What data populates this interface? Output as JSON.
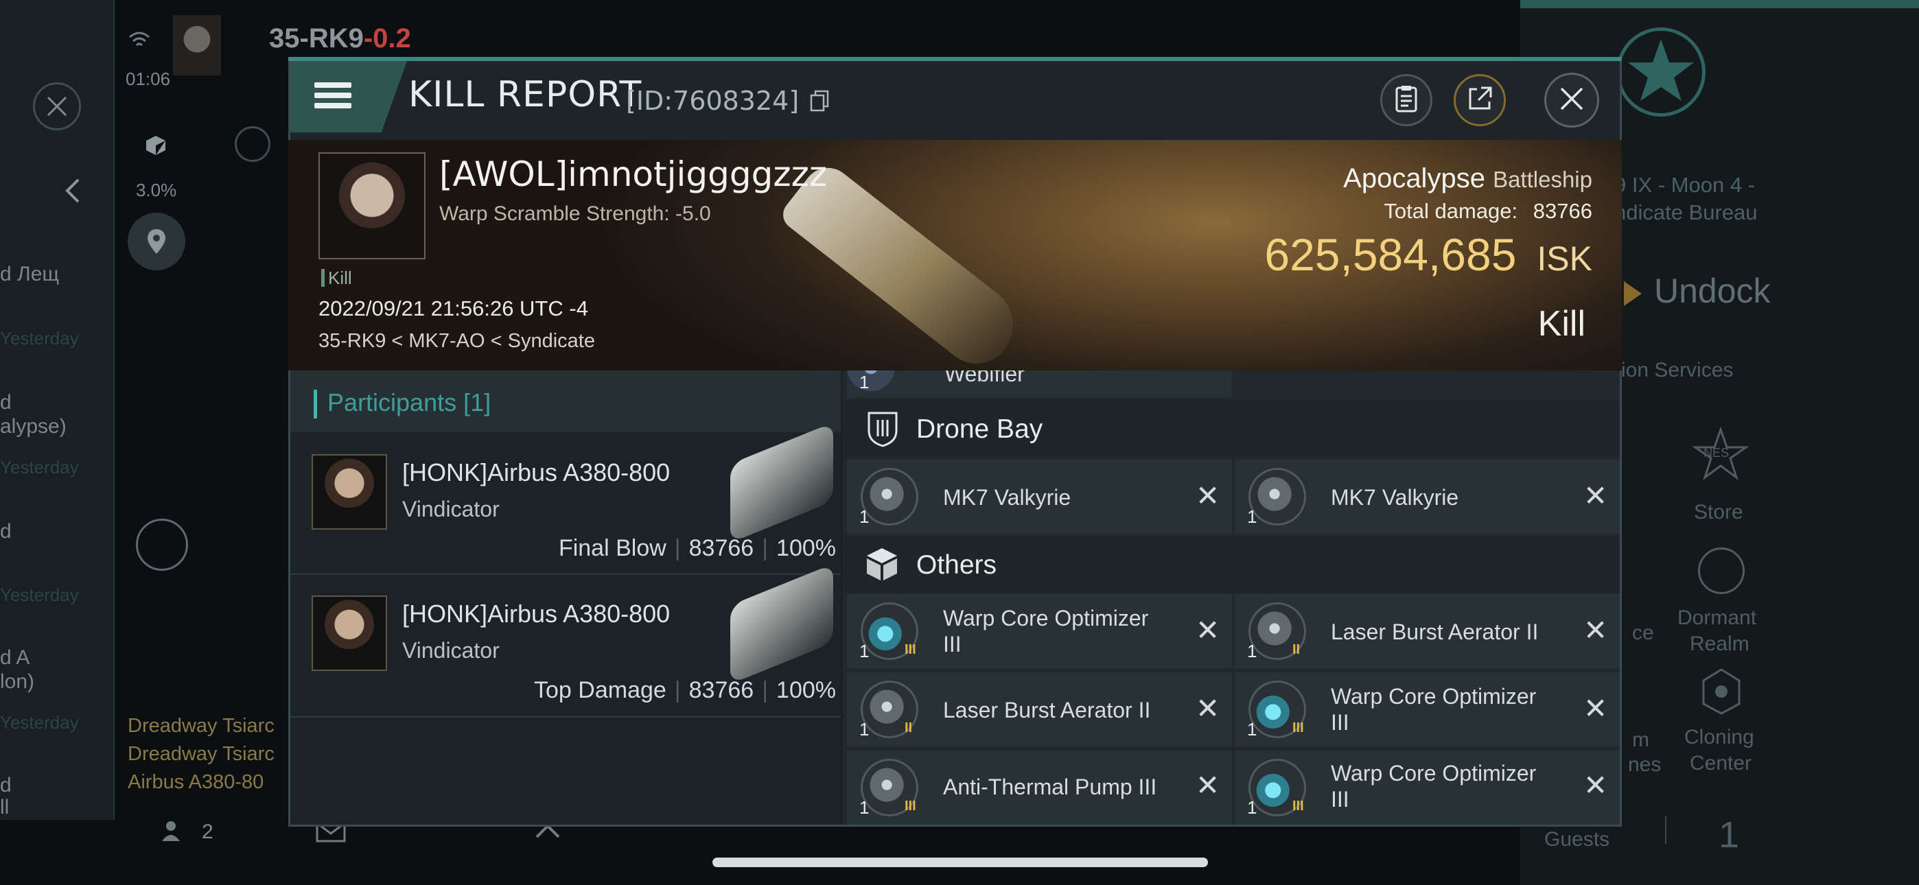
{
  "background": {
    "system_name": "35-RK9",
    "system_security": "-0.2",
    "clock": "01:06",
    "percent": "3.0%",
    "left_list": [
      "d Лещ",
      "Yesterday",
      "d",
      "alypse)",
      "Yesterday",
      "d",
      "Yesterday",
      "d A",
      "lon)",
      "Yesterday",
      "d",
      "ll"
    ],
    "chat_lines": [
      "Dreadway Tsiarc",
      "Dreadway Tsiarc",
      "Airbus A380-80"
    ],
    "bottom_count": "2",
    "station_text_1": "9 IX - Moon 4 -",
    "station_text_2": "ndicate Bureau",
    "undock": "Undock",
    "services": "ion Services",
    "store": "Store",
    "dormant_1": "Dormant",
    "dormant_2": "Realm",
    "cloning_1": "Cloning",
    "cloning_2": "Center",
    "frag_ce": "ce",
    "frag_m": "m",
    "frag_nes": "nes",
    "nes_logo": "NES",
    "guests": "Guests",
    "guests_count": "1"
  },
  "header": {
    "title": "KILL REPORT",
    "report_id": "[ID:7608324]"
  },
  "victim": {
    "pilot": "[AWOL]imnotjiggggzzz",
    "warp_scramble": "Warp Scramble Strength: -5.0",
    "tag": "Kill",
    "datetime": "2022/09/21 21:56:26 UTC -4",
    "location": "35-RK9 < MK7-AO < Syndicate",
    "ship": "Apocalypse",
    "ship_class": "Battleship",
    "total_damage_label": "Total damage:",
    "total_damage": "83766",
    "isk_value": "625,584,685",
    "isk_unit": "ISK",
    "result": "Kill"
  },
  "participants": {
    "label": "Participants",
    "count": "[1]",
    "rows": [
      {
        "pilot": "[HONK]Airbus A380-800",
        "ship": "Vindicator",
        "role": "Final Blow",
        "damage": "83766",
        "percent": "100%"
      },
      {
        "pilot": "[HONK]Airbus A380-800",
        "ship": "Vindicator",
        "role": "Top Damage",
        "damage": "83766",
        "percent": "100%"
      }
    ]
  },
  "items": {
    "partial_top": {
      "qty": "1",
      "name": "Webifier"
    },
    "drone_bay": {
      "label": "Drone Bay",
      "items": [
        {
          "qty": "1",
          "name": "MK7  Valkyrie"
        },
        {
          "qty": "1",
          "name": "MK7  Valkyrie"
        }
      ]
    },
    "others": {
      "label": "Others",
      "items": [
        {
          "qty": "1",
          "name": "Warp Core Optimizer III",
          "line1": "Warp Core Optimizer",
          "line2": "III",
          "tier": "III",
          "icon": "cyan"
        },
        {
          "qty": "1",
          "name": "Laser Burst Aerator II",
          "line1": "Laser Burst Aerator II",
          "line2": "",
          "tier": "II",
          "icon": "grey"
        },
        {
          "qty": "1",
          "name": "Laser Burst Aerator II",
          "line1": "Laser Burst Aerator II",
          "line2": "",
          "tier": "II",
          "icon": "grey"
        },
        {
          "qty": "1",
          "name": "Warp Core Optimizer III",
          "line1": "Warp Core Optimizer",
          "line2": "III",
          "tier": "III",
          "icon": "cyan"
        },
        {
          "qty": "1",
          "name": "Anti-Thermal Pump III",
          "line1": "Anti-Thermal Pump III",
          "line2": "",
          "tier": "III",
          "icon": "grey"
        },
        {
          "qty": "1",
          "name": "Warp Core Optimizer III",
          "line1": "Warp Core Optimizer",
          "line2": "III",
          "tier": "III",
          "icon": "cyan"
        }
      ]
    },
    "remove_symbol": "✕"
  },
  "colors": {
    "accent_teal": "#3e8784",
    "isk_gold": "#f3d27f",
    "security_red": "#e0483f"
  }
}
